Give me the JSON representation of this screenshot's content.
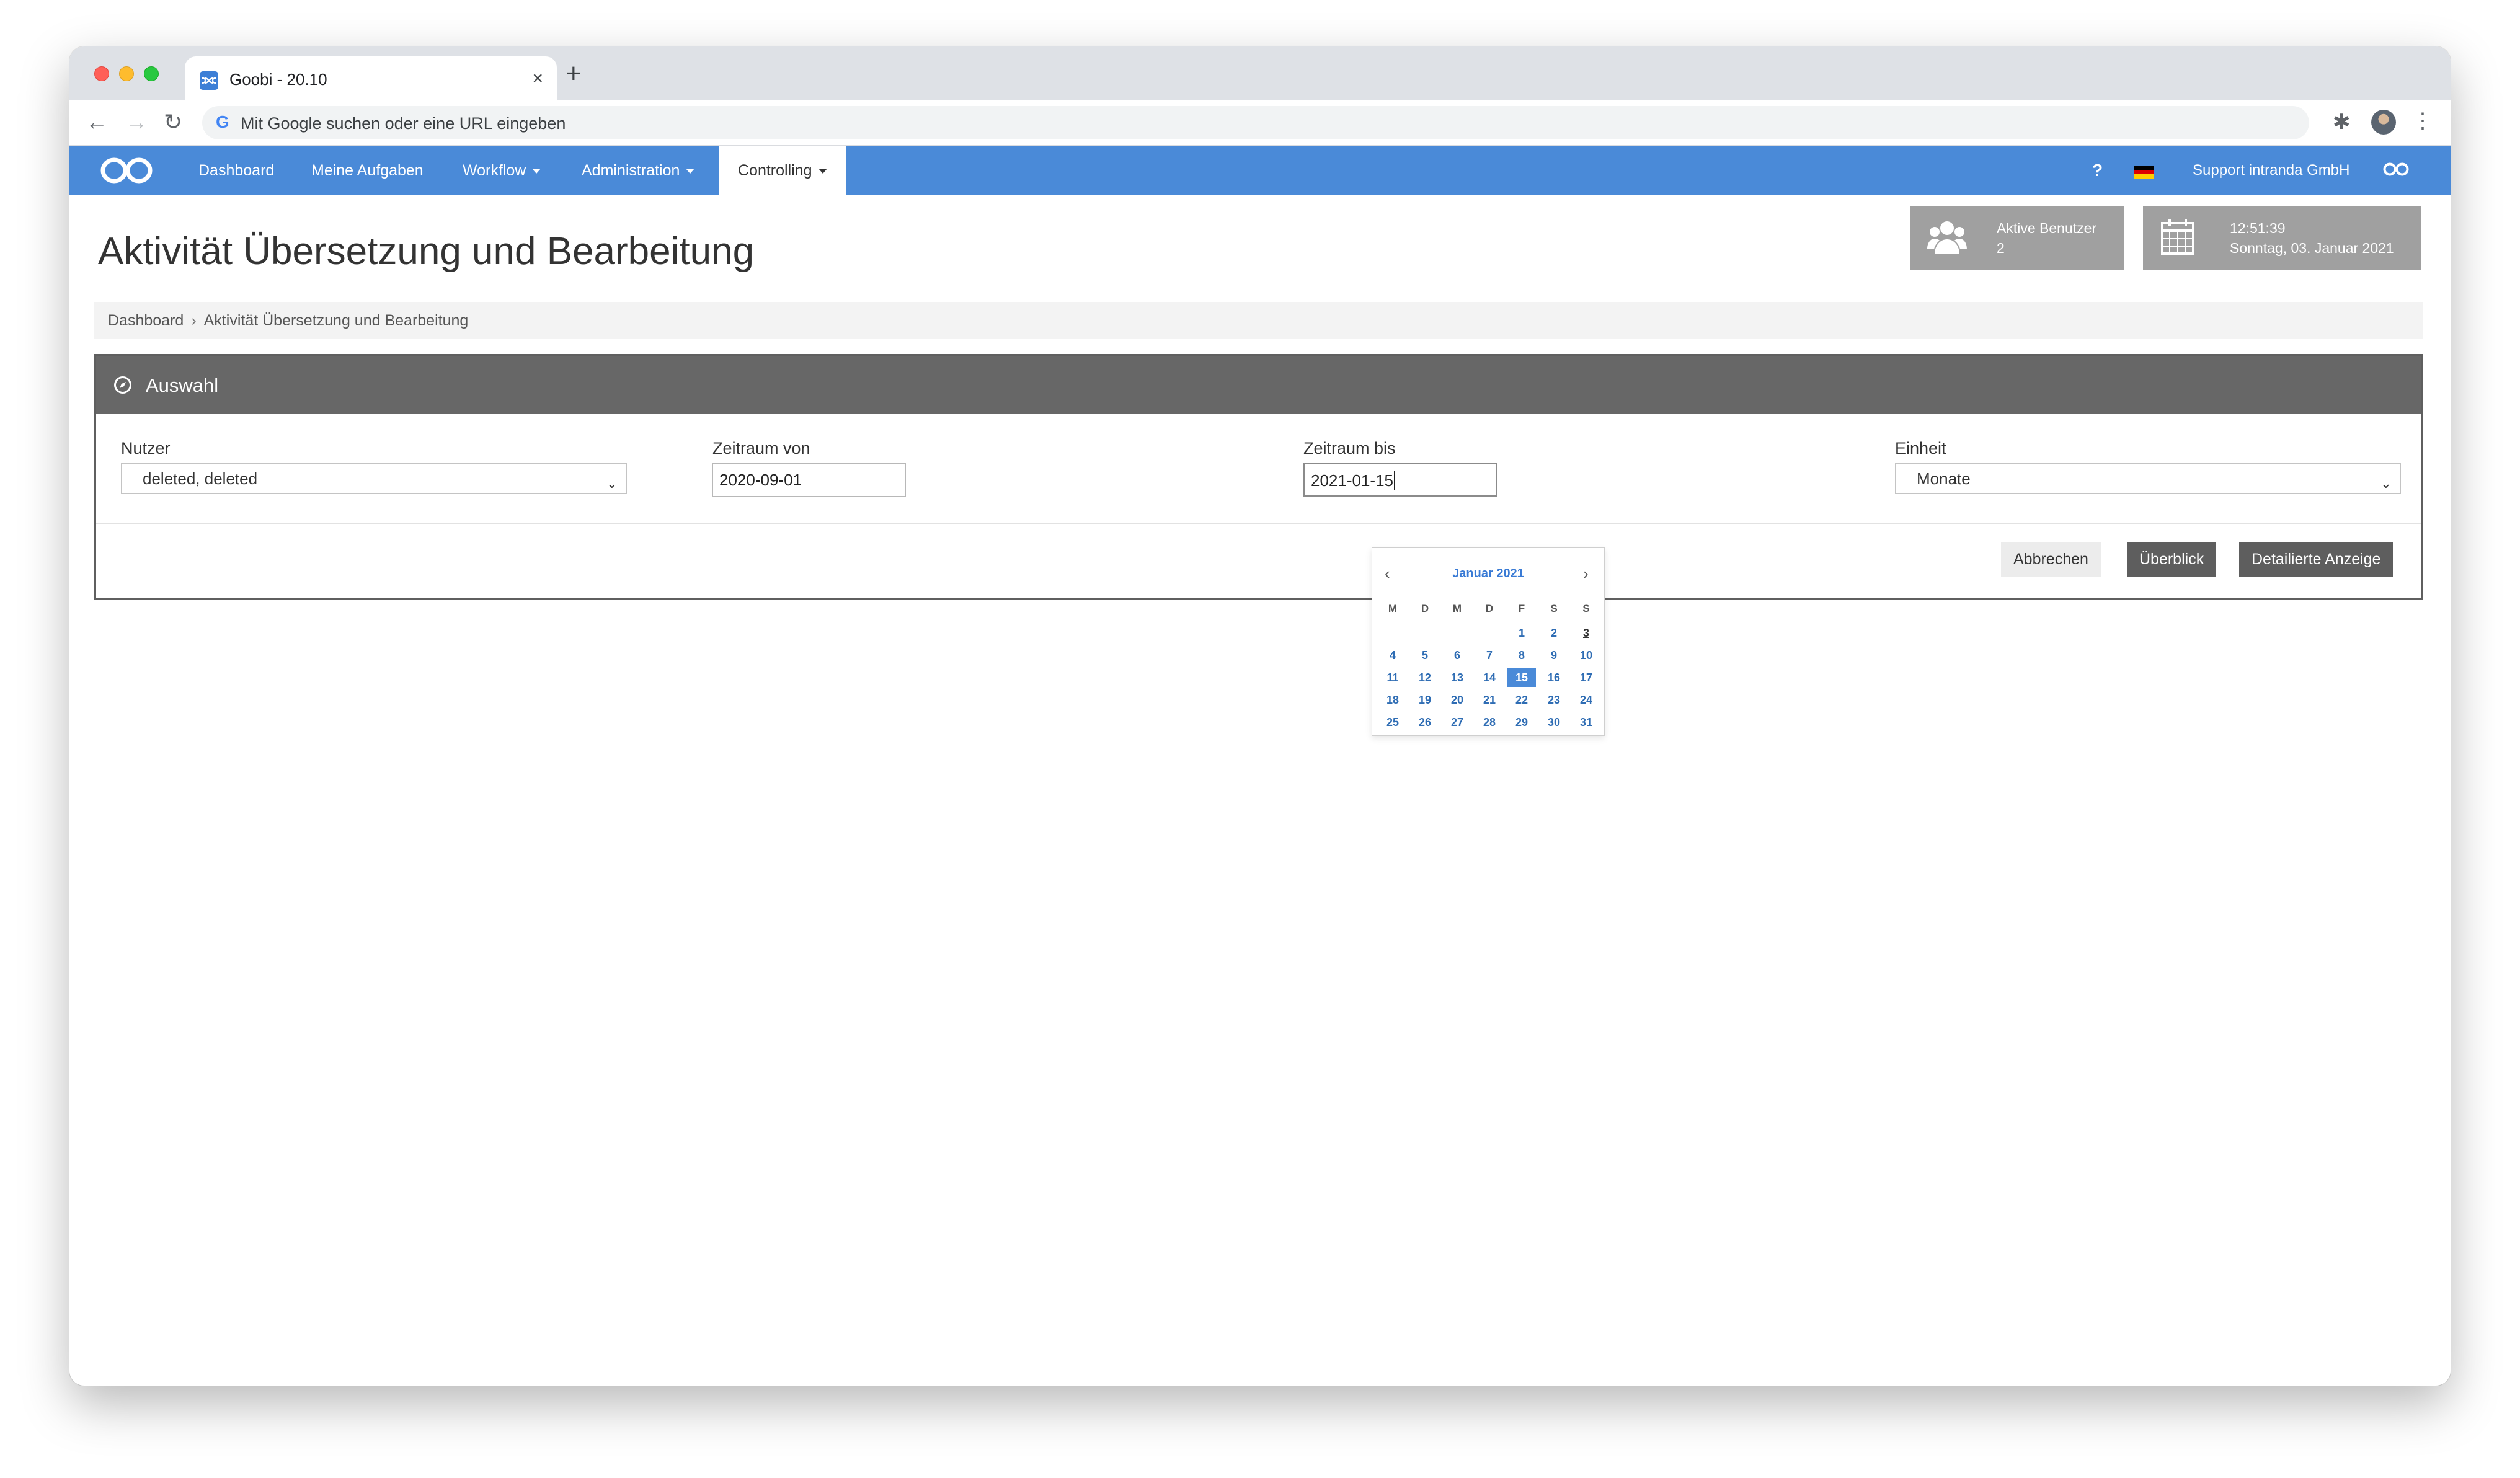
{
  "browser": {
    "tab_title": "Goobi - 20.10",
    "tab_close": "×",
    "new_tab": "+",
    "address_placeholder": "Mit Google suchen oder eine URL eingeben",
    "google_letter": "G"
  },
  "navbar": {
    "items": [
      {
        "label": "Dashboard"
      },
      {
        "label": "Meine Aufgaben"
      },
      {
        "label": "Workflow"
      },
      {
        "label": "Administration"
      },
      {
        "label": "Controlling"
      }
    ],
    "active_item": "Controlling",
    "help": "?",
    "user": "Support intranda GmbH"
  },
  "page": {
    "title": "Aktivität Übersetzung und Bearbeitung"
  },
  "widgets": {
    "users_label": "Aktive Benutzer",
    "users_count": "2",
    "time": "12:51:39",
    "date": "Sonntag, 03. Januar 2021"
  },
  "breadcrumb": {
    "home": "Dashboard",
    "separator": "›",
    "current": "Aktivität Übersetzung und Bearbeitung"
  },
  "panel": {
    "title": "Auswahl",
    "fields": {
      "nutzer_label": "Nutzer",
      "nutzer_value": "deleted, deleted",
      "von_label": "Zeitraum von",
      "von_value": "2020-09-01",
      "bis_label": "Zeitraum bis",
      "bis_value": "2021-01-15",
      "einheit_label": "Einheit",
      "einheit_value": "Monate"
    },
    "buttons": {
      "cancel": "Abbrechen",
      "overview": "Überblick",
      "detailed": "Detailierte Anzeige"
    }
  },
  "datepicker": {
    "prev": "‹",
    "next": "›",
    "month_title": "Januar 2021",
    "weekdays": [
      "M",
      "D",
      "M",
      "D",
      "F",
      "S",
      "S"
    ],
    "weeks": [
      [
        "",
        "",
        "",
        "",
        "1",
        "2",
        "3"
      ],
      [
        "4",
        "5",
        "6",
        "7",
        "8",
        "9",
        "10"
      ],
      [
        "11",
        "12",
        "13",
        "14",
        "15",
        "16",
        "17"
      ],
      [
        "18",
        "19",
        "20",
        "21",
        "22",
        "23",
        "24"
      ],
      [
        "25",
        "26",
        "27",
        "28",
        "29",
        "30",
        "31"
      ]
    ],
    "selected_day": "15",
    "today_day": "3"
  },
  "colors": {
    "navbar": "#4a8ad8",
    "panel_header": "#676767",
    "widget": "#a0a0a0",
    "selected_day": "#4a8ad8"
  },
  "icons": {
    "back": "arrow-left-icon",
    "forward": "arrow-right-icon",
    "reload": "reload-icon",
    "extensions": "puzzle-icon",
    "menu": "kebab-menu-icon",
    "brand": "infinity-logo-icon",
    "users_widget": "users-icon",
    "date_widget": "calendar-icon",
    "panel": "compass-icon",
    "flag": "german-flag-icon"
  }
}
